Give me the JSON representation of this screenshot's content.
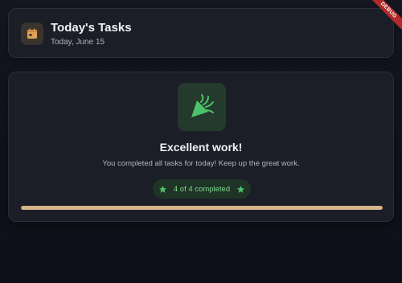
{
  "header": {
    "title": "Today's Tasks",
    "date": "Today, June 15",
    "icon": "calendar-icon",
    "icon_color": "#e0a15a"
  },
  "completion": {
    "icon": "party-popper-icon",
    "accent_color": "#4cc26a",
    "heading": "Excellent work!",
    "message": "You completed all tasks for today! Keep up the great work.",
    "completed": 4,
    "total": 4,
    "status_text": "4 of 4 completed",
    "progress": 1.0,
    "progress_color": "#d7b58a"
  },
  "debug_banner": "DEBUG"
}
